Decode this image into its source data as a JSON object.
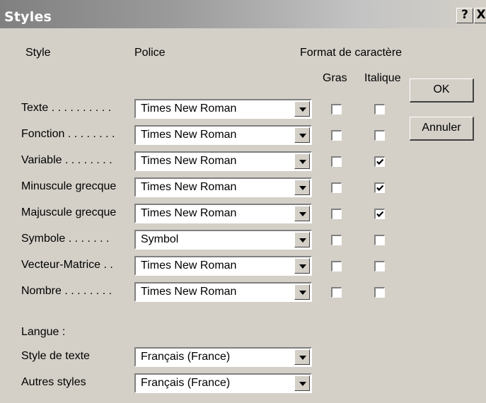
{
  "window": {
    "title": "Styles",
    "help_glyph": "?",
    "close_glyph": "X"
  },
  "headers": {
    "style": "Style",
    "police": "Police",
    "format": "Format de caractère",
    "gras": "Gras",
    "italique": "Italique"
  },
  "buttons": {
    "ok": "OK",
    "annuler": "Annuler"
  },
  "rows": [
    {
      "label": "Texte . . . . . . . . . .",
      "font": "Times New Roman",
      "bold": false,
      "italic": false
    },
    {
      "label": "Fonction . . . . . . . .",
      "font": "Times New Roman",
      "bold": false,
      "italic": false
    },
    {
      "label": "Variable . . . . . . . .",
      "font": "Times New Roman",
      "bold": false,
      "italic": true
    },
    {
      "label": "Minuscule grecque",
      "font": "Times New Roman",
      "bold": false,
      "italic": true
    },
    {
      "label": "Majuscule grecque",
      "font": "Times New Roman",
      "bold": false,
      "italic": true
    },
    {
      "label": "Symbole . . . . . . .",
      "font": "Symbol",
      "bold": false,
      "italic": false
    },
    {
      "label": "Vecteur-Matrice . .",
      "font": "Times New Roman",
      "bold": false,
      "italic": false
    },
    {
      "label": "Nombre . . . . . . . .",
      "font": "Times New Roman",
      "bold": false,
      "italic": false
    }
  ],
  "langue": {
    "heading": "Langue :",
    "items": [
      {
        "label": "Style de texte",
        "value": "Français (France)"
      },
      {
        "label": "Autres styles",
        "value": "Français (France)"
      }
    ]
  }
}
